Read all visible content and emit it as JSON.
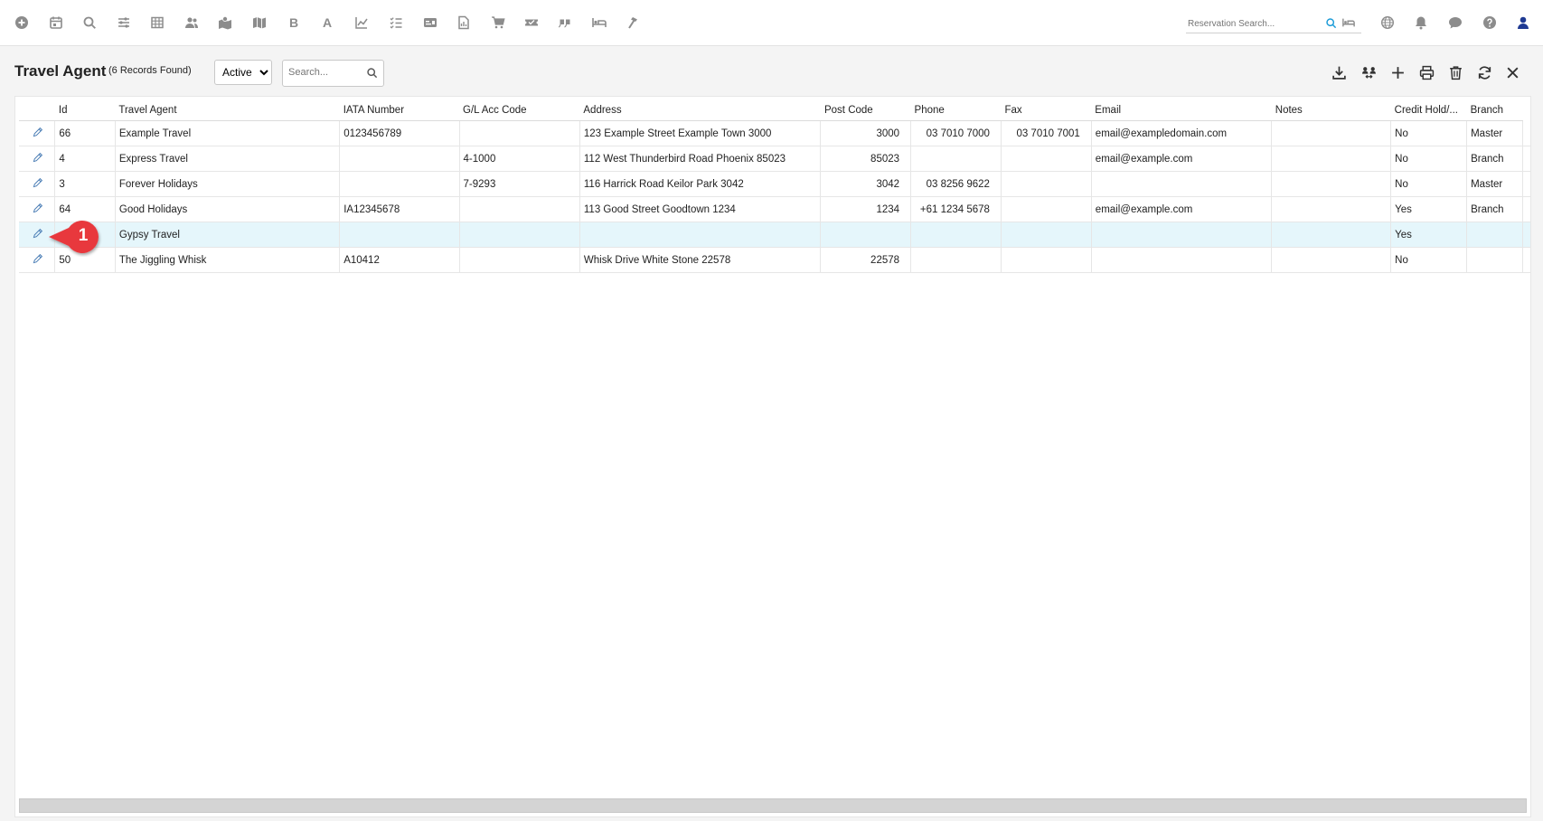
{
  "toolbar": {
    "icons": [
      "add-circle",
      "calendar",
      "search",
      "sliders",
      "grid",
      "users",
      "map-location",
      "map",
      "bold",
      "font",
      "line-chart",
      "checklist",
      "id-card",
      "document",
      "cart",
      "ticket",
      "quote",
      "bed",
      "hammer"
    ],
    "bold_label": "B",
    "font_label": "A"
  },
  "reservation_search": {
    "placeholder": "Reservation Search..."
  },
  "page": {
    "title": "Travel Agent",
    "record_count": "(6 Records Found)",
    "status_options": [
      "Active"
    ],
    "status_selected": "Active",
    "search_placeholder": "Search..."
  },
  "table": {
    "columns": [
      "Id",
      "Travel Agent",
      "IATA Number",
      "G/L Acc Code",
      "Address",
      "Post Code",
      "Phone",
      "Fax",
      "Email",
      "Notes",
      "Credit Hold/...",
      "Branch"
    ],
    "rows": [
      {
        "id": "66",
        "agent": "Example Travel",
        "iata": "0123456789",
        "gl": "",
        "address": "123 Example Street Example Town 3000",
        "post": "3000",
        "phone": "03 7010 7000",
        "fax": "03 7010 7001",
        "email": "email@exampledomain.com",
        "notes": "",
        "credit": "No",
        "branch": "Master"
      },
      {
        "id": "4",
        "agent": "Express Travel",
        "iata": "",
        "gl": "4-1000",
        "address": "112 West Thunderbird Road Phoenix 85023",
        "post": "85023",
        "phone": "",
        "fax": "",
        "email": "email@example.com",
        "notes": "",
        "credit": "No",
        "branch": "Branch"
      },
      {
        "id": "3",
        "agent": "Forever Holidays",
        "iata": "",
        "gl": "7-9293",
        "address": "116 Harrick Road Keilor Park 3042",
        "post": "3042",
        "phone": "03 8256 9622",
        "fax": "",
        "email": "",
        "notes": "",
        "credit": "No",
        "branch": "Master"
      },
      {
        "id": "64",
        "agent": "Good Holidays",
        "iata": "IA12345678",
        "gl": "",
        "address": "113 Good Street Goodtown 1234",
        "post": "1234",
        "phone": "+61 1234 5678",
        "fax": "",
        "email": "email@example.com",
        "notes": "",
        "credit": "Yes",
        "branch": "Branch"
      },
      {
        "id": "",
        "agent": "Gypsy Travel",
        "iata": "",
        "gl": "",
        "address": "",
        "post": "",
        "phone": "",
        "fax": "",
        "email": "",
        "notes": "",
        "credit": "Yes",
        "branch": ""
      },
      {
        "id": "50",
        "agent": "The Jiggling Whisk",
        "iata": "A10412",
        "gl": "",
        "address": "Whisk Drive White Stone 22578",
        "post": "22578",
        "phone": "",
        "fax": "",
        "email": "",
        "notes": "",
        "credit": "No",
        "branch": ""
      }
    ]
  },
  "callout": {
    "number": "1",
    "color": "#e8383d"
  }
}
